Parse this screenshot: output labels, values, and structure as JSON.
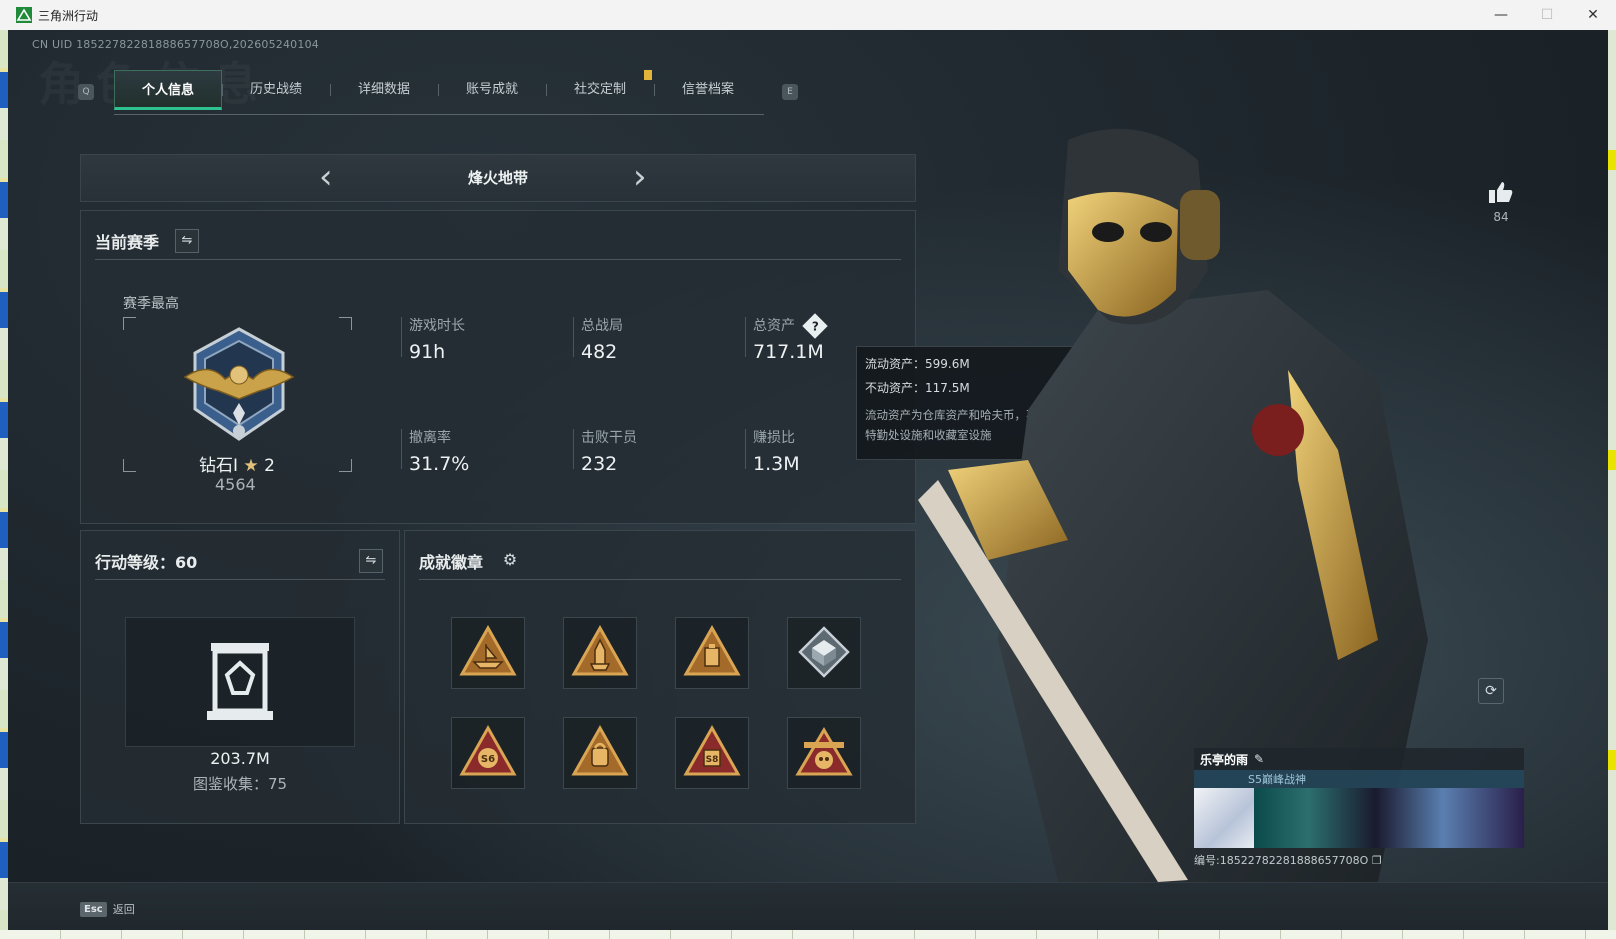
{
  "window": {
    "title": "三角洲行动",
    "minimize": "—",
    "maximize": "☐",
    "close": "✕"
  },
  "uid_text": "CN UID 18522782281888657708O,202605240104",
  "watermark": "角色信息",
  "tabs": {
    "left_key": "Q",
    "right_key": "E",
    "items": [
      "个人信息",
      "历史战绩",
      "详细数据",
      "账号成就",
      "社交定制",
      "信誉档案"
    ]
  },
  "season": {
    "name": "烽火地带",
    "prev": "‹",
    "next": "›"
  },
  "current_season": {
    "title": "当前赛季",
    "best_label": "赛季最高",
    "rank_name": "钻石Ⅰ",
    "rank_stars": "2",
    "rank_points": "4564",
    "stats": [
      {
        "label": "游戏时长",
        "value": "91h"
      },
      {
        "label": "总战局",
        "value": "482"
      },
      {
        "label": "总资产",
        "value": "717.1M"
      },
      {
        "label": "撤离率",
        "value": "31.7%"
      },
      {
        "label": "击败干员",
        "value": "232"
      },
      {
        "label": "赚损比",
        "value": "1.3M"
      }
    ]
  },
  "tooltip": {
    "liquid": "流动资产：599.6M",
    "fixed": "不动资产：117.5M",
    "desc_1": "流动资产为仓库资产和哈夫币，不动资产为",
    "desc_2": "特勤处设施和收藏室设施"
  },
  "action_level": {
    "title": "行动等级：60",
    "value": "203.7M",
    "collection": "图鉴收集：75"
  },
  "achievements": {
    "title": "成就徽章",
    "badges": [
      "ship",
      "rocket",
      "crate",
      "cube",
      "s6",
      "s5-bag",
      "s8",
      "s9-skull"
    ]
  },
  "likes": {
    "count": "84"
  },
  "profile": {
    "name": "乐亭的雨",
    "title": "S5巅峰战神",
    "id_text": "编号:18522782281888657708O"
  },
  "bottom": {
    "esc": "Esc",
    "back": "返回"
  },
  "colors": {
    "accent_green": "#2ec28f",
    "gold": "#c9a24a",
    "panel": "#242d33"
  }
}
